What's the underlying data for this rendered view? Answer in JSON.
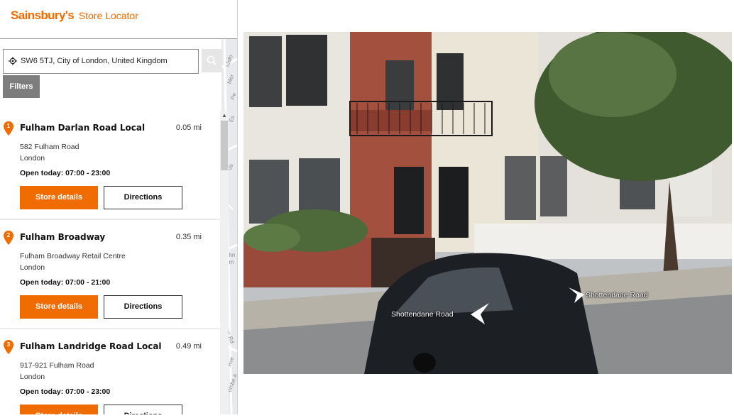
{
  "header": {
    "brand_name": "Sainsbury's",
    "brand_suffix": "Store Locator"
  },
  "search": {
    "value": "SW6 5TJ, City of London, United Kingdom",
    "placeholder": ""
  },
  "filters_label": "Filters",
  "stores": [
    {
      "number": "1",
      "name": "Fulham Darlan Road Local",
      "distance": "0.05 mi",
      "address_line1": "582 Fulham Road",
      "address_line2": "London",
      "hours": "Open today: 07:00 - 23:00",
      "details_label": "Store details",
      "directions_label": "Directions"
    },
    {
      "number": "2",
      "name": "Fulham Broadway",
      "distance": "0.35 mi",
      "address_line1": "Fulham Broadway Retail Centre",
      "address_line2": "London",
      "hours": "Open today: 07:00 - 21:00",
      "details_label": "Store details",
      "directions_label": "Directions"
    },
    {
      "number": "3",
      "name": "Fulham Landridge Road Local",
      "distance": "0.49 mi",
      "address_line1": "917-921 Fulham Road",
      "address_line2": "London",
      "hours": "Open today: 07:00 - 23:00",
      "details_label": "Store details",
      "directions_label": "Directions"
    }
  ],
  "map_fragments": [
    "ulafo",
    "Mer",
    "Pe",
    "Es",
    "Va",
    "ohn",
    "rim",
    "ster Rd",
    "Ave",
    "ombe A"
  ],
  "streetview": {
    "road_label_left": "Shottendane Road",
    "road_label_right": "Shottendane Road"
  },
  "colors": {
    "accent": "#f06c00",
    "filters_bg": "#7d7d7d"
  },
  "icons": {
    "location": "crosshair-location-icon",
    "search": "search-icon",
    "pin": "map-pin-icon"
  }
}
